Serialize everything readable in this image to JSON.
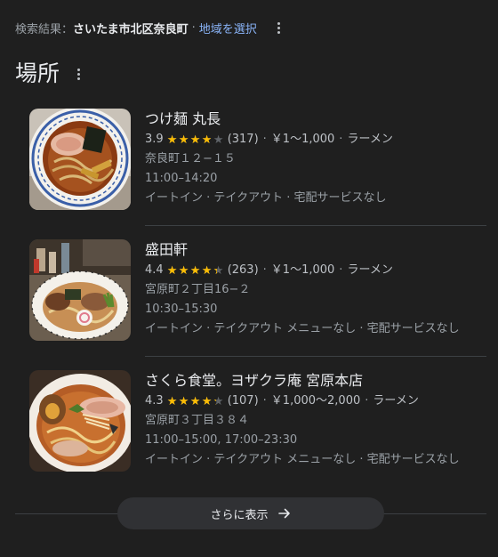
{
  "location": {
    "prefix": "検索結果：",
    "place": "さいたま市北区奈良町",
    "dot": "·",
    "change_link": "地域を選択"
  },
  "section": {
    "title": "場所"
  },
  "results": [
    {
      "name": "つけ麺 丸長",
      "rating": "3.9",
      "rating_value": 3.9,
      "reviews": "(317)",
      "price": "￥1～1,000",
      "category": "ラーメン",
      "address": "奈良町１２−１５",
      "hours": "11:00–14:20",
      "services": "イートイン · テイクアウト · 宅配サービスなし",
      "thumb_icon": "shoyu-ramen-photo"
    },
    {
      "name": "盛田軒",
      "rating": "4.4",
      "rating_value": 4.4,
      "reviews": "(263)",
      "price": "￥1～1,000",
      "category": "ラーメン",
      "address": "宮原町２丁目16−２",
      "hours": "10:30–15:30",
      "services": "イートイン · テイクアウト メニューなし · 宅配サービスなし",
      "thumb_icon": "ramen-bowl-photo"
    },
    {
      "name": "さくら食堂。ヨザクラ庵 宮原本店",
      "rating": "4.3",
      "rating_value": 4.3,
      "reviews": "(107)",
      "price": "￥1,000～2,000",
      "category": "ラーメン",
      "address": "宮原町３丁目３８４",
      "hours": "11:00–15:00, 17:00–23:30",
      "services": "イートイン · テイクアウト メニューなし · 宅配サービスなし",
      "thumb_icon": "egg-ramen-photo"
    }
  ],
  "more_button": {
    "label": "さらに表示",
    "icon": "arrow-right-icon"
  },
  "colors": {
    "background": "#1f1f1f",
    "link": "#8ab4f8",
    "star": "#fbbc04",
    "button": "#303134"
  }
}
